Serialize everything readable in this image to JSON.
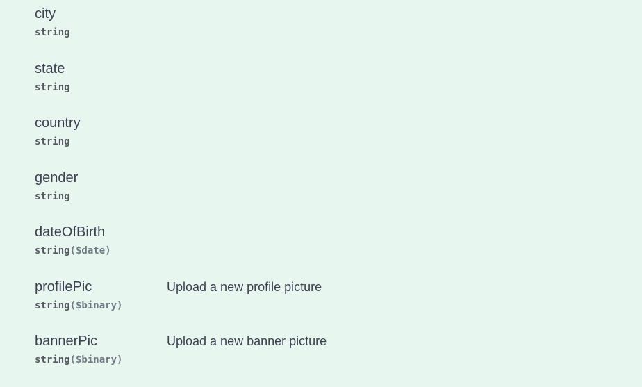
{
  "properties": [
    {
      "name": "city",
      "type": "string",
      "format": "",
      "description": ""
    },
    {
      "name": "state",
      "type": "string",
      "format": "",
      "description": ""
    },
    {
      "name": "country",
      "type": "string",
      "format": "",
      "description": ""
    },
    {
      "name": "gender",
      "type": "string",
      "format": "",
      "description": ""
    },
    {
      "name": "dateOfBirth",
      "type": "string",
      "format": "($date)",
      "description": ""
    },
    {
      "name": "profilePic",
      "type": "string",
      "format": "($binary)",
      "description": "Upload a new profile picture"
    },
    {
      "name": "bannerPic",
      "type": "string",
      "format": "($binary)",
      "description": "Upload a new banner picture"
    }
  ]
}
